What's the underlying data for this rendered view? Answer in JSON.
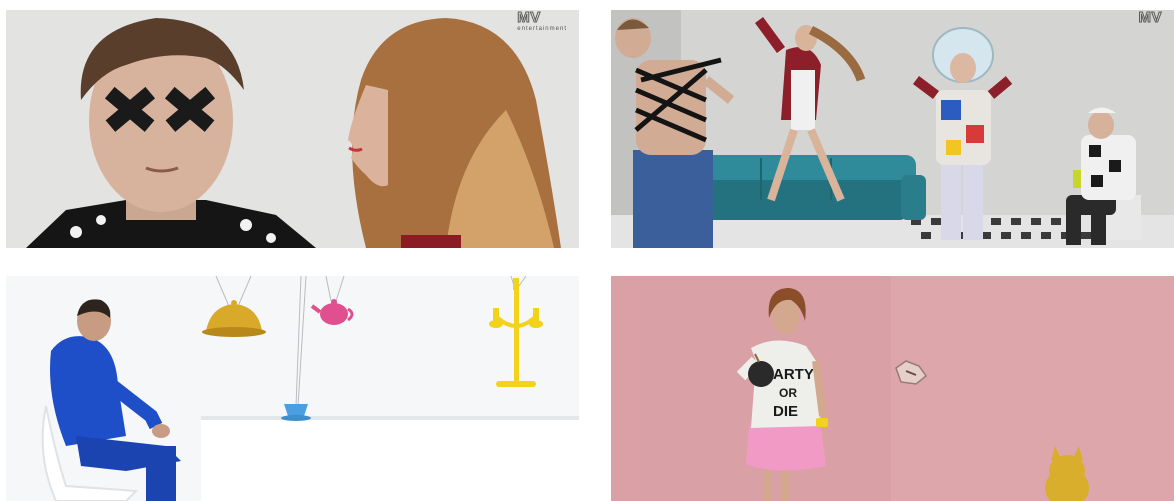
{
  "tiles": [
    {
      "name": "tile-tape-eyes",
      "watermark": "MV",
      "watermark_sub": "entertainment"
    },
    {
      "name": "tile-sofa-dance",
      "watermark": "MV",
      "watermark_sub": ""
    },
    {
      "name": "tile-blue-tracksuit",
      "watermark": "",
      "watermark_sub": ""
    },
    {
      "name": "tile-pink-wall",
      "shirt_text": [
        "ARTY",
        "OR",
        "DIE"
      ]
    }
  ],
  "colors": {
    "tile1_bg": "#e2e2e0",
    "tile2_bg": "#d6d7d6",
    "tile3_bg": "#f4f6f8",
    "tile4_bg": "#d9a0a6",
    "sofa": "#2f8a9a",
    "tracksuit": "#1f4fc8",
    "gold": "#d9a92a",
    "pink_teapot": "#e0508e",
    "yellow_candelabra": "#f2d21a"
  }
}
